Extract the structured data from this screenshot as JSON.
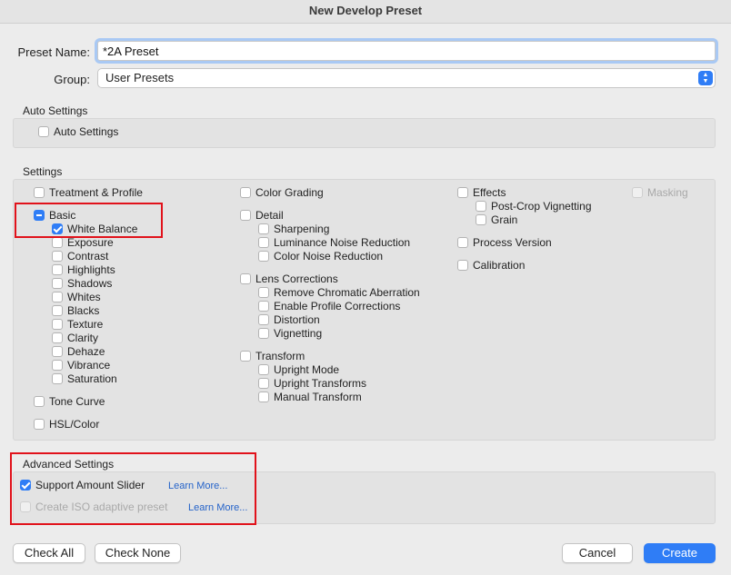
{
  "window": {
    "title": "New Develop Preset"
  },
  "form": {
    "preset_name_label": "Preset Name:",
    "preset_name_value": "*2A Preset",
    "group_label": "Group:",
    "group_value": "User Presets"
  },
  "auto_settings": {
    "title": "Auto Settings",
    "checkbox_label": "Auto Settings"
  },
  "settings": {
    "title": "Settings",
    "col1": {
      "treatment_profile": "Treatment & Profile",
      "basic": "Basic",
      "basic_items": [
        "White Balance",
        "Exposure",
        "Contrast",
        "Highlights",
        "Shadows",
        "Whites",
        "Blacks",
        "Texture",
        "Clarity",
        "Dehaze",
        "Vibrance",
        "Saturation"
      ],
      "tone_curve": "Tone Curve",
      "hsl_color": "HSL/Color"
    },
    "col2": {
      "color_grading": "Color Grading",
      "detail": "Detail",
      "detail_items": [
        "Sharpening",
        "Luminance Noise Reduction",
        "Color Noise Reduction"
      ],
      "lens_corrections": "Lens Corrections",
      "lens_items": [
        "Remove Chromatic Aberration",
        "Enable Profile Corrections",
        "Distortion",
        "Vignetting"
      ],
      "transform": "Transform",
      "transform_items": [
        "Upright Mode",
        "Upright Transforms",
        "Manual Transform"
      ]
    },
    "col3": {
      "effects": "Effects",
      "effects_items": [
        "Post-Crop Vignetting",
        "Grain"
      ],
      "process_version": "Process Version",
      "calibration": "Calibration"
    },
    "col4": {
      "masking": "Masking"
    }
  },
  "advanced": {
    "title": "Advanced Settings",
    "support_amount_slider": "Support Amount Slider",
    "create_iso_adaptive": "Create ISO adaptive preset",
    "learn_more_1": "Learn More...",
    "learn_more_2": "Learn More..."
  },
  "buttons": {
    "check_all": "Check All",
    "check_none": "Check None",
    "cancel": "Cancel",
    "create": "Create"
  },
  "colors": {
    "accent": "#2f7df6",
    "highlight_box": "#e1121b",
    "link": "#2563c9"
  }
}
